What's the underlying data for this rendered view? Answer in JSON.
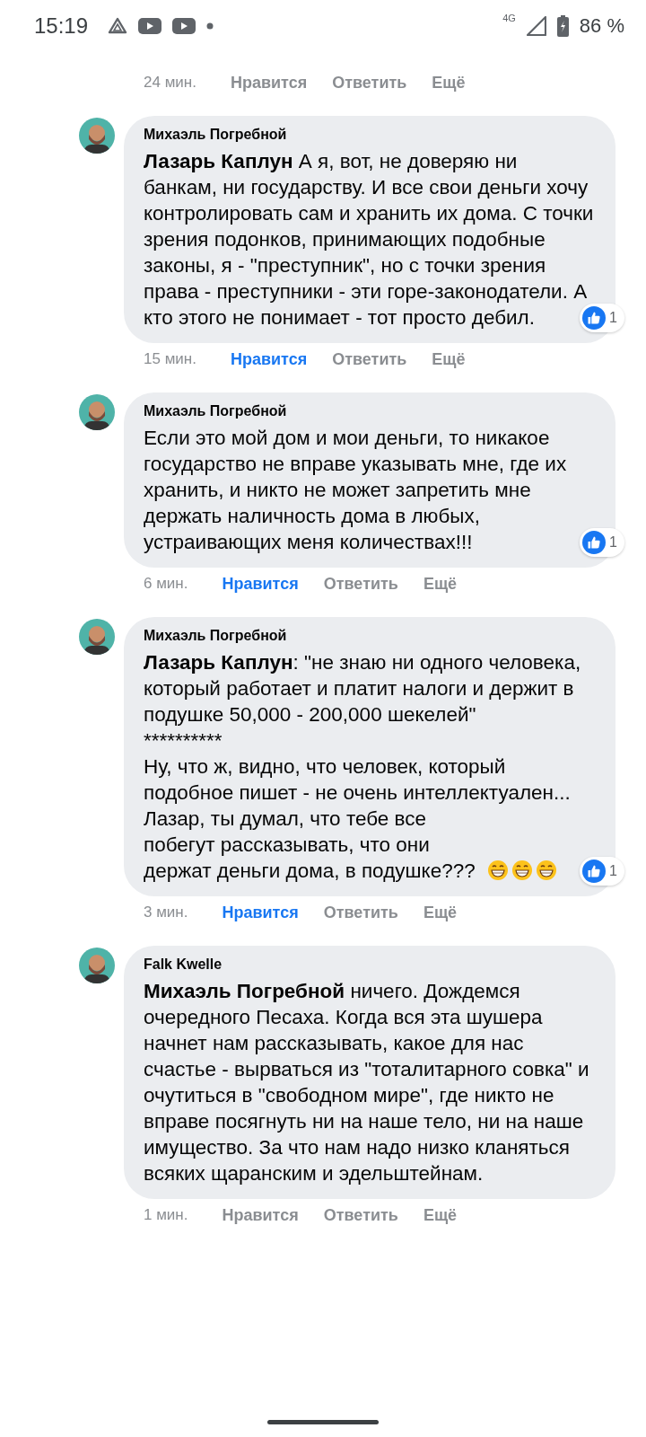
{
  "status_bar": {
    "time": "15:19",
    "network": "4G",
    "battery": "86 %"
  },
  "previous_comment": {
    "liked": false,
    "actions": [
      {
        "kind": "time",
        "label": "24 мин."
      },
      {
        "kind": "like",
        "label": "Нравится"
      },
      {
        "kind": "reply",
        "label": "Ответить"
      },
      {
        "kind": "more",
        "label": "Ещё"
      }
    ]
  },
  "comments": [
    {
      "author": "Михаэль Погребной",
      "paragraphs": [
        {
          "kind": "rich",
          "text": "**Лазарь Каплун** А я, вот, не доверяю ни банкам, ни государству. И все свои деньги хочу контролировать сам и хранить их дома. С точки зрения подонков, принимающих подобные законы, я - \"преступник\", но с точки зрения права - преступники - эти горе-законодатели. А кто этого не понимает - тот просто дебил."
        }
      ],
      "reactions": "1",
      "liked": true,
      "actions": [
        {
          "kind": "time",
          "label": "15 мин."
        },
        {
          "kind": "like",
          "label": "Нравится"
        },
        {
          "kind": "reply",
          "label": "Ответить"
        },
        {
          "kind": "more",
          "label": "Ещё"
        }
      ]
    },
    {
      "author": "Михаэль Погребной",
      "paragraphs": [
        {
          "kind": "plain",
          "text": "Если это мой дом и мои деньги, то никакое государство не вправе указывать мне, где их хранить, и никто не может запретить мне держать наличность дома в любых, устраивающих меня количествах!!!"
        }
      ],
      "reactions": "1",
      "liked": true,
      "actions": [
        {
          "kind": "time",
          "label": "6 мин."
        },
        {
          "kind": "like",
          "label": "Нравится"
        },
        {
          "kind": "reply",
          "label": "Ответить"
        },
        {
          "kind": "more",
          "label": "Ещё"
        }
      ]
    },
    {
      "author": "Михаэль Погребной",
      "paragraphs": [
        {
          "kind": "rich",
          "text": "**Лазарь Каплун**: \"не знаю ни одного человека, который работает и платит налоги и держит в подушке 50,000 - 200,000 шекелей\""
        },
        {
          "kind": "plain",
          "text": "**********"
        },
        {
          "kind": "plain",
          "text": "Ну, что ж, видно, что человек, который подобное пишет - не очень интеллектуален..."
        },
        {
          "kind": "plain",
          "text": "Лазар, ты думал, что тебе все побегут рассказывать, что они держат деньги дома, в подушке???",
          "emojis": [
            {
              "kind": "grin"
            },
            {
              "kind": "grin"
            },
            {
              "kind": "grin"
            }
          ]
        }
      ],
      "reactions": "1",
      "liked": true,
      "actions": [
        {
          "kind": "time",
          "label": "3 мин."
        },
        {
          "kind": "like",
          "label": "Нравится"
        },
        {
          "kind": "reply",
          "label": "Ответить"
        },
        {
          "kind": "more",
          "label": "Ещё"
        }
      ]
    },
    {
      "author": "Falk Kwelle",
      "paragraphs": [
        {
          "kind": "rich",
          "text": "**Михаэль Погребной** ничего. Дождемся очередного Песаха. Когда вся эта шушера начнет нам рассказывать, какое для нас счастье - вырваться из \"тоталитарного совка\" и очутиться в \"свободном мире\", где никто не вправе посягнуть ни на наше тело, ни на наше имущество. За что нам надо низко кланяться всяких щаранским и эдельштейнам."
        }
      ],
      "liked": false,
      "actions": [
        {
          "kind": "time",
          "label": "1 мин."
        },
        {
          "kind": "like",
          "label": "Нравится"
        },
        {
          "kind": "reply",
          "label": "Ответить"
        },
        {
          "kind": "more",
          "label": "Ещё"
        }
      ]
    }
  ]
}
